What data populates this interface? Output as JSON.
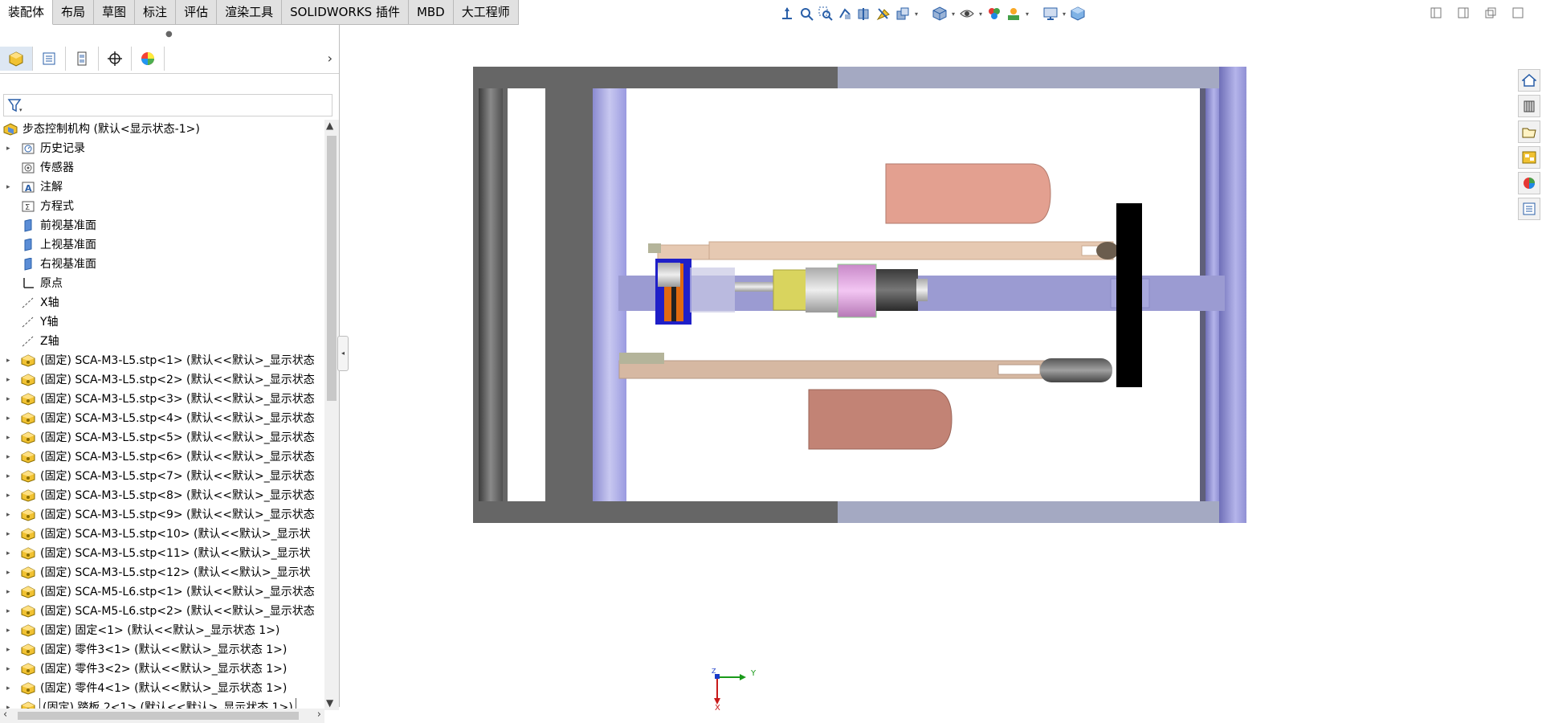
{
  "command_tabs": [
    "装配体",
    "布局",
    "草图",
    "标注",
    "评估",
    "渲染工具",
    "SOLIDWORKS 插件",
    "MBD",
    "大工程师"
  ],
  "active_tab": "装配体",
  "feature_tree": {
    "root": "步态控制机构  (默认<显示状态-1>)",
    "items": [
      "历史记录",
      "传感器",
      "注解",
      "方程式",
      "前视基准面",
      "上视基准面",
      "右视基准面",
      "原点",
      "X轴",
      "Y轴",
      "Z轴",
      "(固定) SCA-M3-L5.stp<1> (默认<<默认>_显示状态",
      "(固定) SCA-M3-L5.stp<2> (默认<<默认>_显示状态",
      "(固定) SCA-M3-L5.stp<3> (默认<<默认>_显示状态",
      "(固定) SCA-M3-L5.stp<4> (默认<<默认>_显示状态",
      "(固定) SCA-M3-L5.stp<5> (默认<<默认>_显示状态",
      "(固定) SCA-M3-L5.stp<6> (默认<<默认>_显示状态",
      "(固定) SCA-M3-L5.stp<7> (默认<<默认>_显示状态",
      "(固定) SCA-M3-L5.stp<8> (默认<<默认>_显示状态",
      "(固定) SCA-M3-L5.stp<9> (默认<<默认>_显示状态",
      "(固定) SCA-M3-L5.stp<10> (默认<<默认>_显示状",
      "(固定) SCA-M3-L5.stp<11> (默认<<默认>_显示状",
      "(固定) SCA-M3-L5.stp<12> (默认<<默认>_显示状",
      "(固定) SCA-M5-L6.stp<1> (默认<<默认>_显示状态",
      "(固定) SCA-M5-L6.stp<2> (默认<<默认>_显示状态",
      "(固定) 固定<1> (默认<<默认>_显示状态 1>)",
      "(固定) 零件3<1> (默认<<默认>_显示状态 1>)",
      "(固定) 零件3<2> (默认<<默认>_显示状态 1>)",
      "(固定) 零件4<1> (默认<<默认>_显示状态 1>)",
      "(固定) 踏板 2<1> (默认<<默认>_显示状态 1>)"
    ]
  },
  "triad": {
    "y_label": "Y",
    "x_label": "X",
    "z_label": "Z"
  },
  "colors": {
    "frame_dark": "#666666",
    "frame_light": "#a4a9c2",
    "rail": "#a9a9dc",
    "bar": "#e6c9b2",
    "foot_pad": "#e3a090",
    "pedal": "#000000"
  }
}
